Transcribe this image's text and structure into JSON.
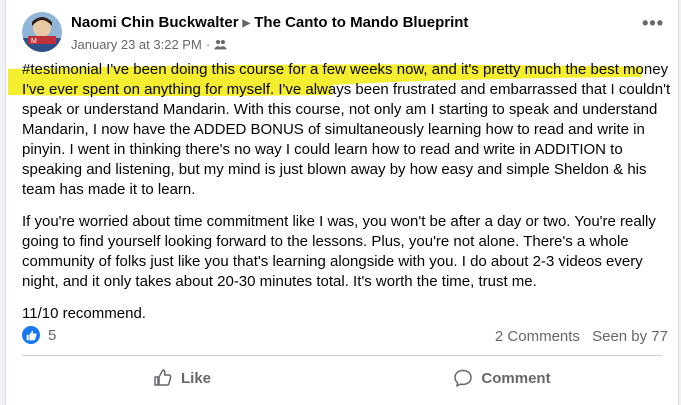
{
  "post": {
    "author": "Naomi Chin Buckwalter",
    "group": "The Canto to Mando Blueprint",
    "timestamp": "January 23 at 3:22 PM",
    "privacy_icon": "group-members-icon",
    "more_label": "•••",
    "paragraphs": [
      "#testimonial I've been doing this course for a few weeks now, and it's pretty much the best money I've ever spent on anything for myself. I've always been frustrated and embarrassed that I couldn't speak or understand Mandarin. With this course, not only am I starting to speak and understand Mandarin, I now have the ADDED BONUS of simultaneously learning how to read and write in pinyin. I went in thinking there's no way I could learn how to read and write in ADDITION to speaking and listening, but my mind is just blown away by how easy and simple Sheldon & his team has made it to learn.",
      "If you're worried about time commitment like I was, you won't be after a day or two. You're really going to find yourself looking forward to the lessons. Plus, you're not alone. There's a whole community of folks just like you that's learning alongside with you. I do about 2-3 videos every night, and it only takes about 20-30 minutes total. It's worth the time, trust me.",
      "11/10 recommend."
    ],
    "highlight_color": "#f4ec1a",
    "reactions_count": "5",
    "comments_count": "2 Comments",
    "seen_by": "Seen by 77"
  },
  "actions": {
    "like_label": "Like",
    "comment_label": "Comment"
  },
  "colors": {
    "accent": "#1877f2",
    "secondary_text": "#65676b"
  }
}
